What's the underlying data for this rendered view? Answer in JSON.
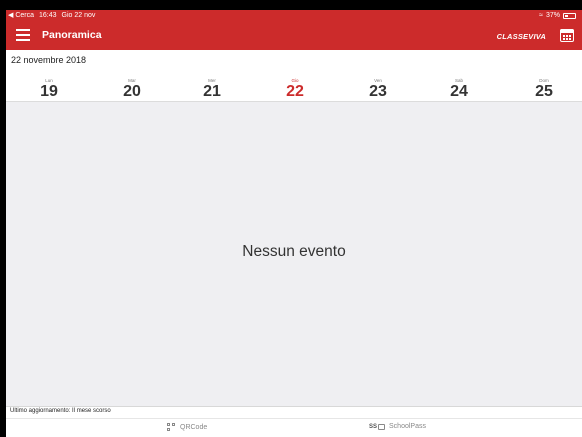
{
  "status": {
    "back_app": "◀ Cerca",
    "time": "16:43",
    "date": "Gio 22 nov",
    "battery": "37%",
    "battery_level": 0.37
  },
  "navbar": {
    "title": "Panoramica",
    "brand": "CLASSEVIVA"
  },
  "date_header": {
    "current_date": "22 novembre 2018"
  },
  "week": [
    {
      "name": "Lun",
      "num": "19"
    },
    {
      "name": "Mar",
      "num": "20"
    },
    {
      "name": "Mer",
      "num": "21"
    },
    {
      "name": "Gio",
      "num": "22"
    },
    {
      "name": "Ven",
      "num": "23"
    },
    {
      "name": "Sab",
      "num": "24"
    },
    {
      "name": "Dom",
      "num": "25"
    }
  ],
  "colors": {
    "accent": "#cc2b2b",
    "background": "#efeff2"
  },
  "events": {
    "empty_message": "Nessun evento"
  },
  "footer": {
    "last_update": "Ultimo aggiornamento: Il mese scorso",
    "tabs": [
      {
        "label": "QRCode",
        "icon": "qrcode-icon"
      },
      {
        "label": "SchoolPass",
        "icon": "schoolpass-icon"
      }
    ]
  }
}
